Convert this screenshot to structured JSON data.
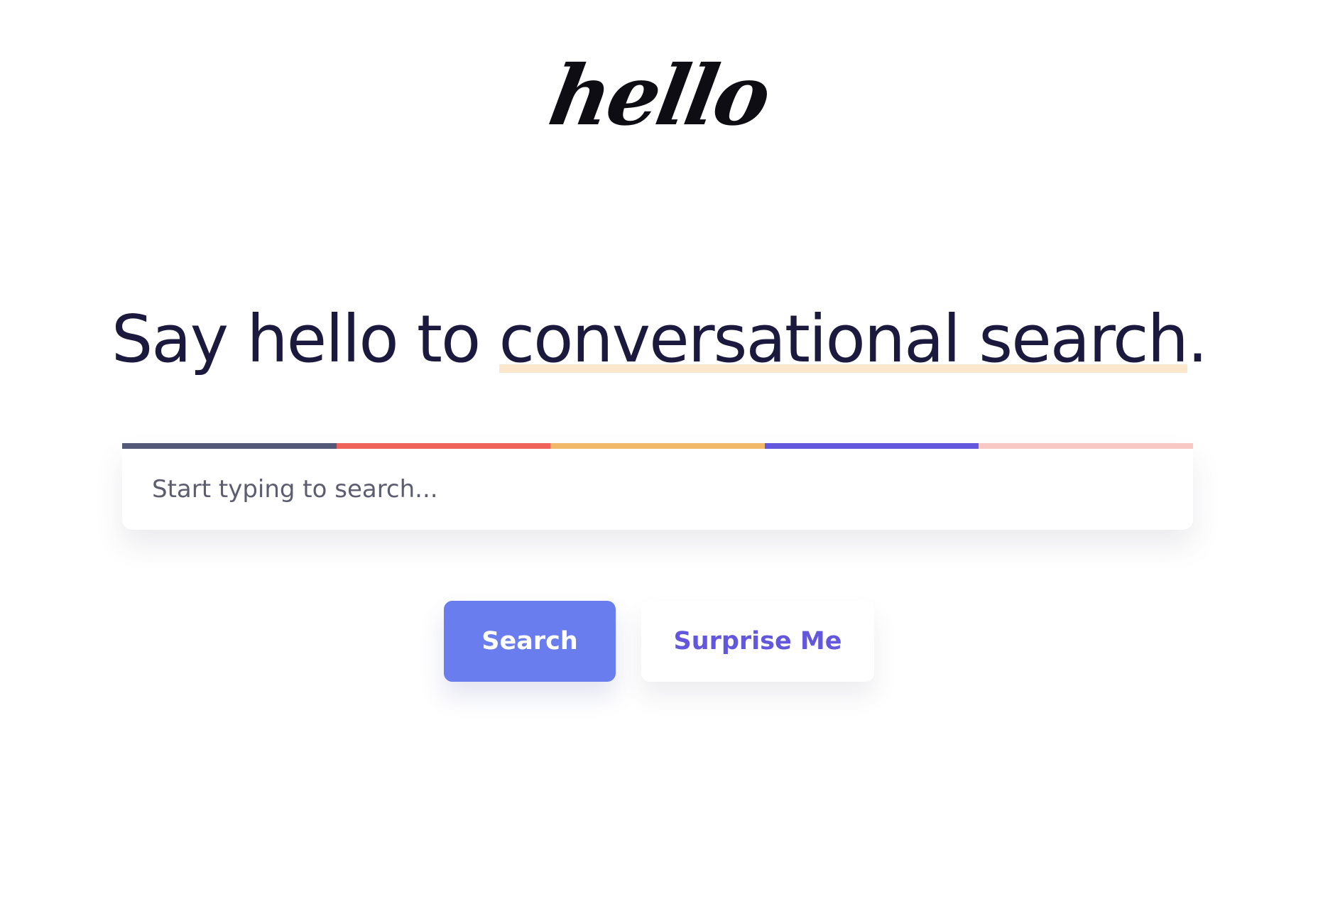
{
  "logo": {
    "text": "hello"
  },
  "headline": {
    "prefix": "Say hello to ",
    "highlight": "conversational search",
    "suffix": "."
  },
  "search": {
    "placeholder": "Start typing to search...",
    "value": "",
    "accent_colors": [
      "#535778",
      "#ef6259",
      "#f1b86a",
      "#6257dd",
      "#f8c8c5"
    ]
  },
  "actions": {
    "search_label": "Search",
    "surprise_label": "Surprise Me"
  },
  "colors": {
    "primary_button": "#6a7dee",
    "secondary_text": "#6257dd",
    "headline_text": "#1b1a3e",
    "highlight": "#fbe8cc"
  }
}
